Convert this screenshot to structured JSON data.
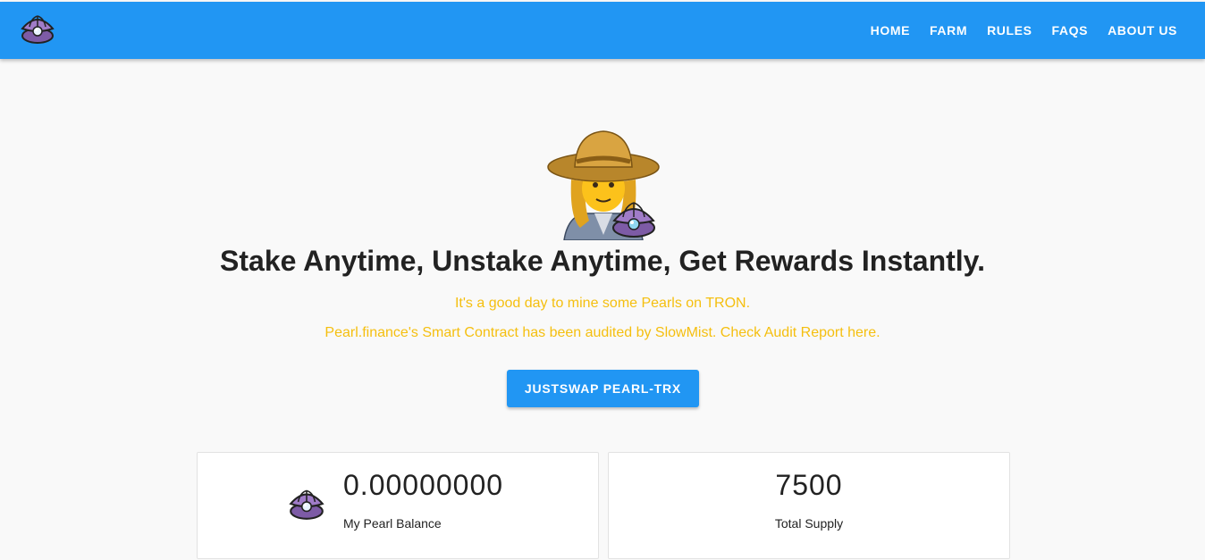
{
  "navbar": {
    "logo_icon": "oyster-pearl-icon",
    "links": [
      "HOME",
      "FARM",
      "RULES",
      "FAQS",
      "ABOUT US"
    ]
  },
  "hero": {
    "figure_icon": "farmer-with-oyster-icon",
    "headline": "Stake Anytime, Unstake Anytime, Get Rewards Instantly.",
    "subtitle_1": "It's a good day to mine some Pearls on TRON.",
    "subtitle_2": "Pearl.finance's Smart Contract has been audited by SlowMist. Check Audit Report here.",
    "cta_label": "JUSTSWAP PEARL-TRX"
  },
  "stats": {
    "balance": {
      "icon": "oyster-pearl-icon",
      "value": "0.00000000",
      "label": "My Pearl Balance"
    },
    "supply": {
      "value": "7500",
      "label": "Total Supply"
    }
  },
  "colors": {
    "primary": "#2196f3",
    "accent_text": "#f5bf0f",
    "background": "#f9f9f9"
  }
}
